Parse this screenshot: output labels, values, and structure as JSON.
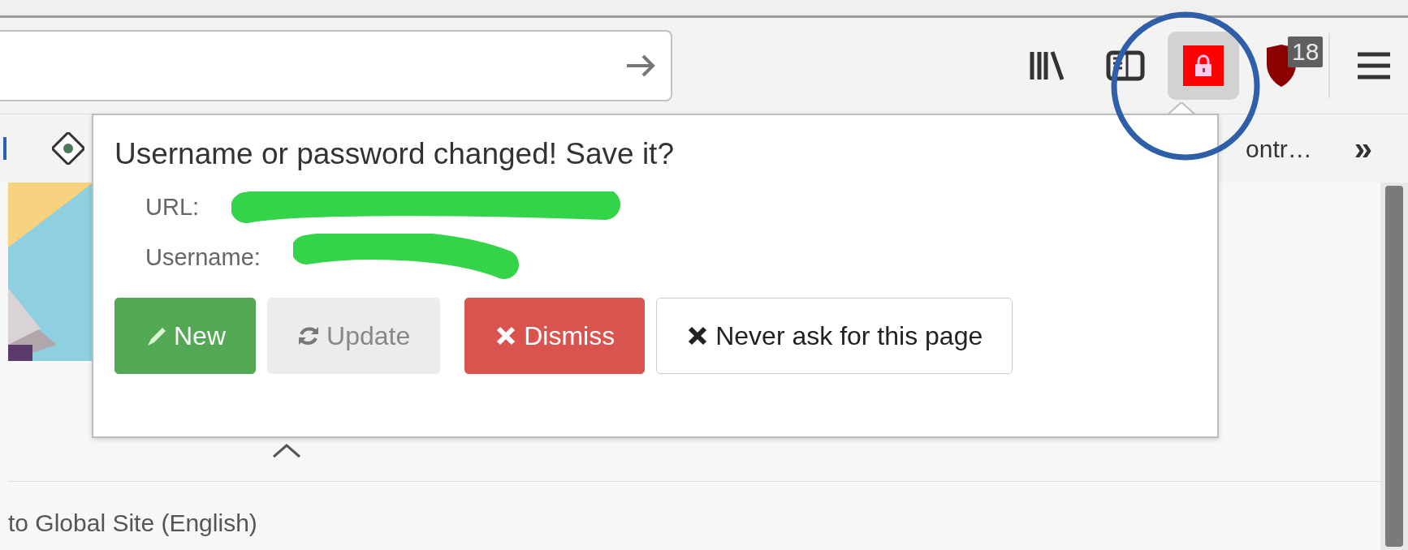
{
  "toolbar": {
    "lock_active": true,
    "badge": "18"
  },
  "bookmarks": {
    "label": "ontr…",
    "overflow": "»"
  },
  "popup": {
    "title": "Username or password changed! Save it?",
    "fields": [
      {
        "label": "URL:"
      },
      {
        "label": "Username:"
      }
    ],
    "buttons": [
      {
        "kind": "success",
        "label": "New",
        "disabled": false
      },
      {
        "kind": "light",
        "label": "Update",
        "disabled": true
      },
      {
        "kind": "danger",
        "label": "Dismiss",
        "disabled": false
      },
      {
        "kind": "outline",
        "label": "Never ask for this page",
        "disabled": false
      }
    ]
  },
  "page": {
    "link": "to Global Site (English)"
  }
}
